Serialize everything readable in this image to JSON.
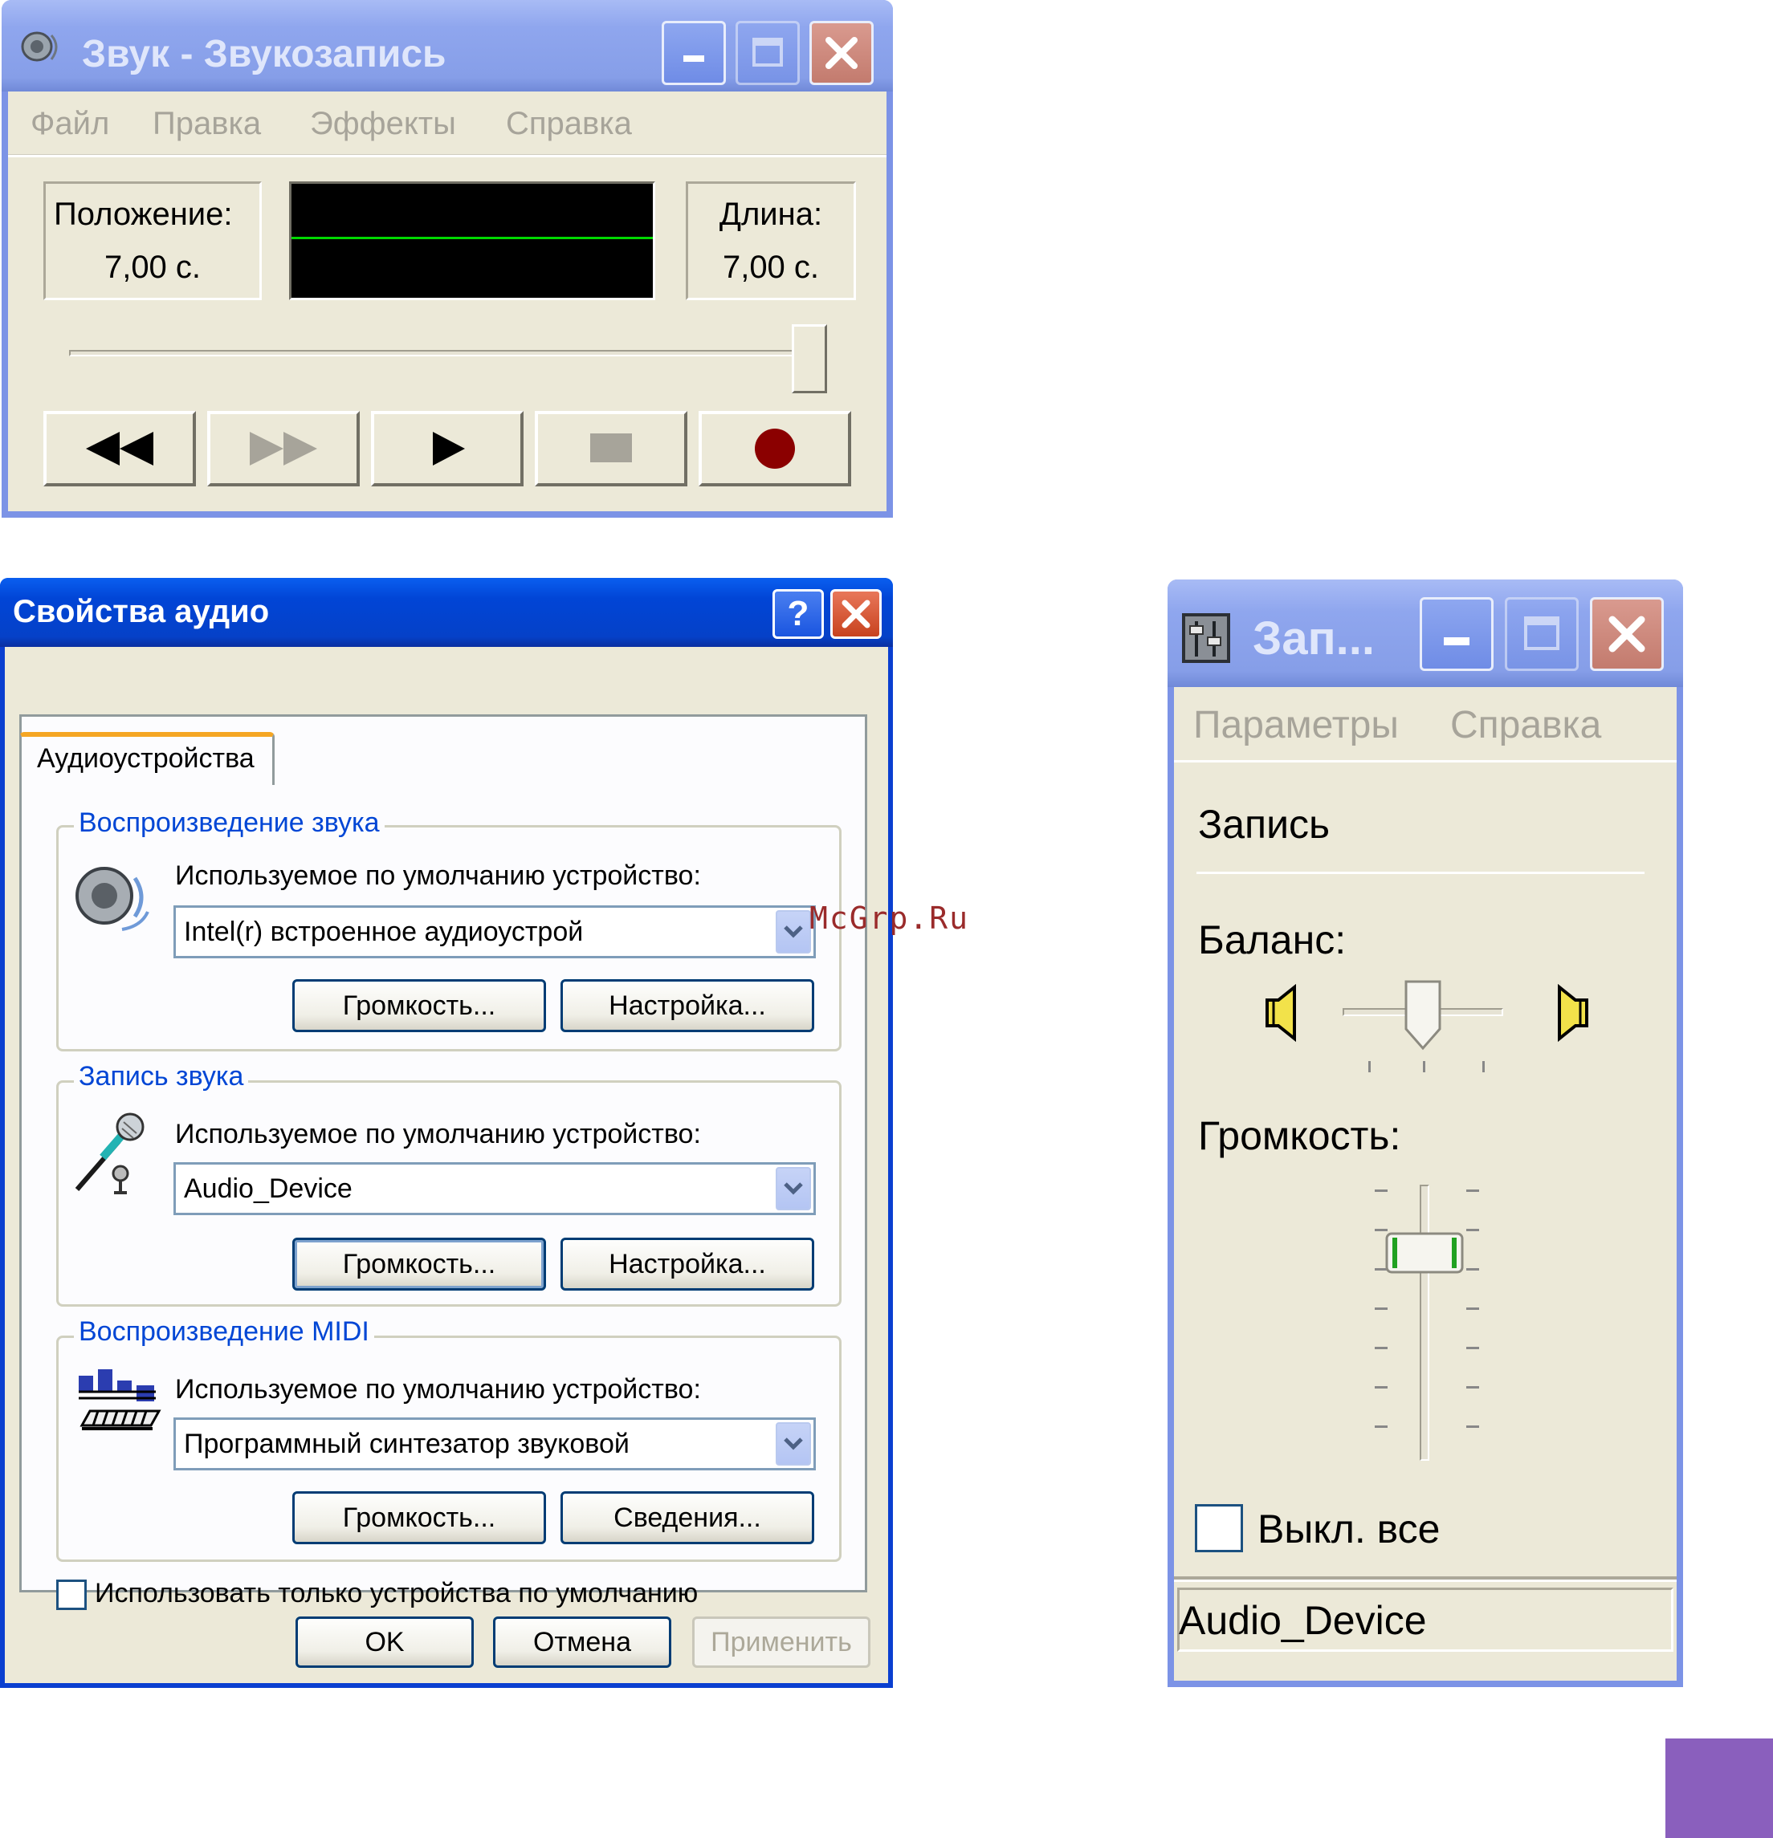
{
  "sound_recorder": {
    "title": "Звук - Звукозапись",
    "menu": [
      "Файл",
      "Правка",
      "Эффекты",
      "Справка"
    ],
    "position_label": "Положение:",
    "position_value": "7,00 с.",
    "length_label": "Длина:",
    "length_value": "7,00 с.",
    "seek_fraction": 1.0,
    "controls": [
      "seek-start",
      "seek-end",
      "play",
      "stop",
      "record"
    ],
    "record_color": "#8b0000",
    "wave_color": "#00d800"
  },
  "audio_properties": {
    "title": "Свойства аудио",
    "help_glyph": "?",
    "tab": "Аудиоустройства",
    "playback": {
      "group": "Воспроизведение звука",
      "label": "Используемое по умолчанию устройство:",
      "device": "Intel(r) встроенное аудиоустрой",
      "volume_button": "Громкость...",
      "settings_button": "Настройка..."
    },
    "recording": {
      "group": "Запись звука",
      "label": "Используемое по умолчанию устройство:",
      "device": "Audio_Device",
      "volume_button": "Громкость...",
      "settings_button": "Настройка..."
    },
    "midi": {
      "group": "Воспроизведение MIDI",
      "label": "Используемое по умолчанию устройство:",
      "device": "Программный синтезатор звуковой",
      "volume_button": "Громкость...",
      "info_button": "Сведения..."
    },
    "default_only_label": "Использовать только устройства по умолчанию",
    "ok": "OK",
    "cancel": "Отмена",
    "apply": "Применить"
  },
  "watermark": "McGrp.Ru",
  "recording_control": {
    "title": "Зап...",
    "menu": [
      "Параметры",
      "Справка"
    ],
    "section": "Запись",
    "balance_label": "Баланс:",
    "balance_fraction": 0.5,
    "volume_label": "Громкость:",
    "volume_fraction": 0.8,
    "mute_label": "Выкл. все",
    "status": "Audio_Device"
  },
  "accent_color": "#8a5fbd"
}
